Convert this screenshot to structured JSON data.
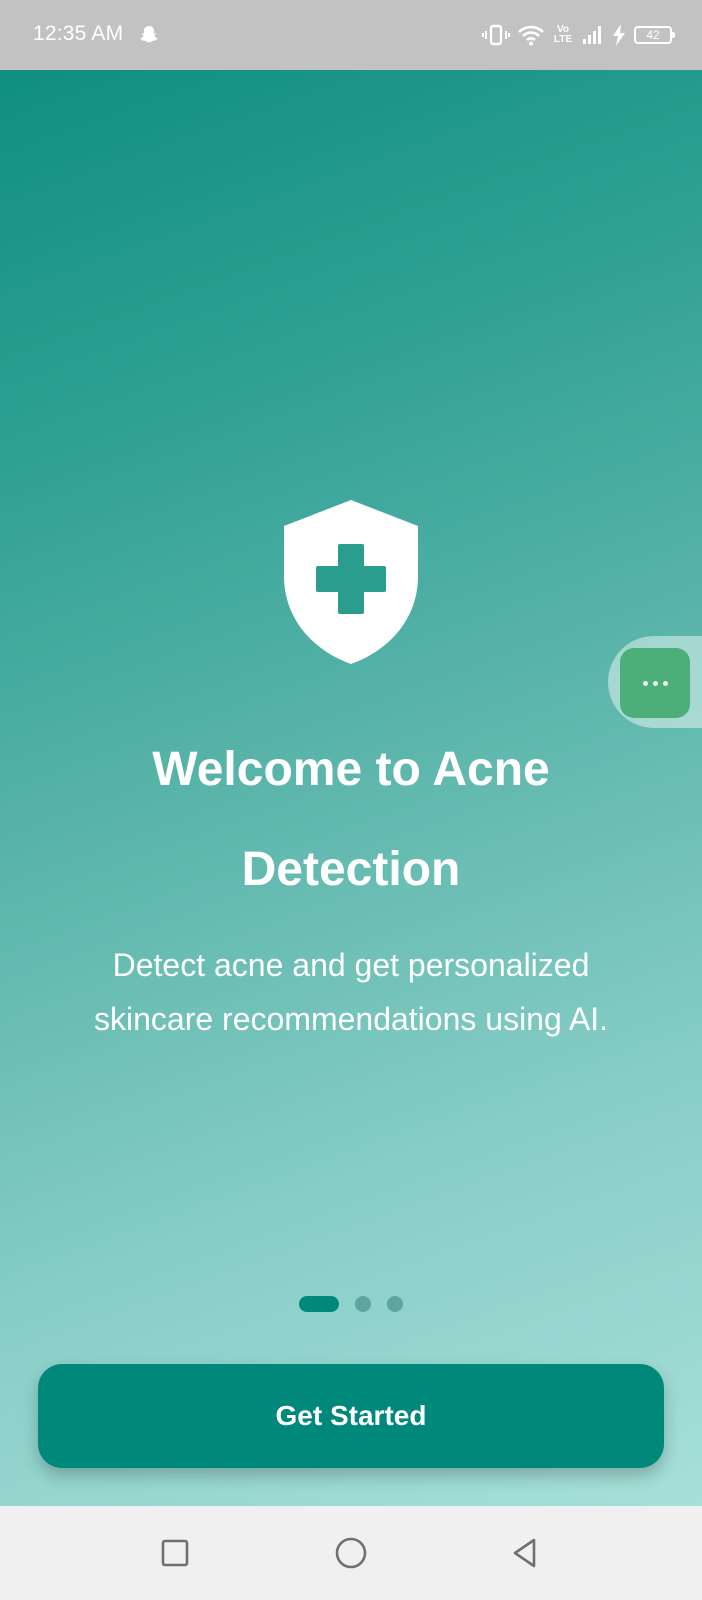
{
  "status_bar": {
    "time": "12:35 AM",
    "battery": "42",
    "volte_top": "Vo",
    "volte_bottom": "LTE",
    "icons": [
      "snapchat-ghost-icon",
      "vibrate-icon",
      "wifi-icon",
      "volte-icon",
      "signal-icon",
      "charging-icon",
      "battery-icon"
    ]
  },
  "onboarding": {
    "title_line1": "Welcome to Acne",
    "title_line2": "Detection",
    "subtitle": "Detect acne and get personalized skincare recommendations using AI.",
    "page_indicator": {
      "total": 3,
      "current": 1
    },
    "cta_label": "Get Started",
    "logo_icon": "shield-plus-icon"
  },
  "floating_bubble": {
    "icon": "more-dots-icon"
  },
  "nav_bar": {
    "buttons": [
      "recent-apps-icon",
      "home-icon",
      "back-icon"
    ]
  },
  "colors": {
    "primary": "#00897b",
    "gradient_top": "#0f8f80",
    "gradient_bottom": "#a7dfd9",
    "bubble": "#4caf7a",
    "status_bar": "#c2c2c2",
    "nav_bar": "#f0f0f0"
  }
}
